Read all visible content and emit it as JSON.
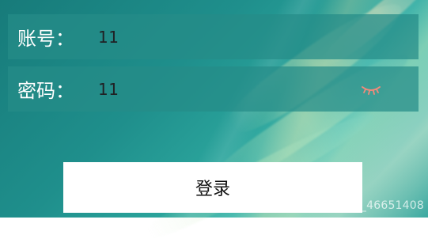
{
  "form": {
    "account_label": "账号：",
    "account_value": "11",
    "password_label": "密码：",
    "password_value": "11",
    "password_toggle_icon": "eye-closed-icon"
  },
  "actions": {
    "login_label": "登录"
  },
  "watermark": {
    "text": "https://blog.csdn.net/m0_46651408"
  },
  "colors": {
    "background_teal": "#1f8f8c",
    "button_bg": "#ffffff"
  }
}
